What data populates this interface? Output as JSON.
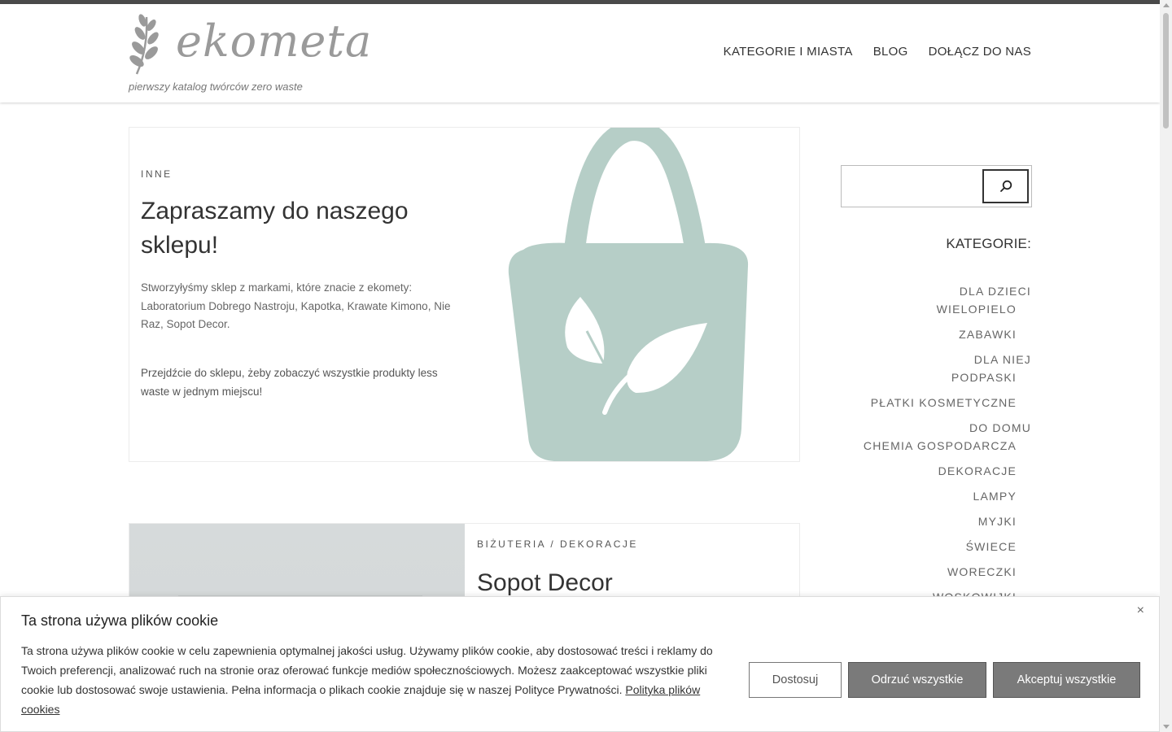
{
  "header": {
    "logo_text": "ekometa",
    "tagline": "pierwszy katalog twórców zero waste",
    "nav": [
      "KATEGORIE I MIASTA",
      "BLOG",
      "DOŁĄCZ DO NAS"
    ]
  },
  "posts": [
    {
      "category": "INNE",
      "title": "Zapraszamy do naszego sklepu!",
      "paragraph1": "Stworzyłyśmy sklep z markami, które znacie z ekomety: Laboratorium Dobrego Nastroju, Kapotka, Krawate Kimono, Nie Raz, Sopot Decor.",
      "paragraph2": "Przejdźcie do sklepu, żeby zobaczyć wszystkie produkty less waste w jednym miejscu!"
    },
    {
      "category": "BIŻUTERIA / DEKORACJE",
      "title": "Sopot Decor"
    }
  ],
  "sidebar": {
    "search_placeholder": "",
    "categories_title": "KATEGORIE:",
    "categories": [
      "DLA DZIECI",
      "WIELOPIELO",
      "ZABAWKI",
      "DLA NIEJ",
      "PODPASKI",
      "PŁATKI KOSMETYCZNE",
      "DO DOMU",
      "CHEMIA GOSPODARCZA",
      "DEKORACJE",
      "LAMPY",
      "MYJKI",
      "ŚWIECE",
      "WORECZKI",
      "WOSKOWIJKI"
    ]
  },
  "cookie_banner": {
    "title": "Ta strona używa plików cookie",
    "text": "Ta strona używa plików cookie w celu zapewnienia optymalnej jakości usług. Używamy plików cookie, aby dostosować treści i reklamy do Twoich preferencji, analizować ruch na stronie oraz oferować funkcje mediów społecznościowych. Możesz zaakceptować wszystkie pliki cookie lub dostosować swoje ustawienia. Pełna informacja o plikach cookie znajduje się w naszej Polityce Prywatności.",
    "link": "Polityka plików cookies",
    "btn_customize": "Dostosuj",
    "btn_reject": "Odrzuć wszystkie",
    "btn_accept": "Akceptuj wszystkie",
    "close": "×"
  },
  "colors": {
    "bag": "#b6cec7",
    "button_gray": "#7a7a7a",
    "logo_gray": "#9a9a9a"
  }
}
